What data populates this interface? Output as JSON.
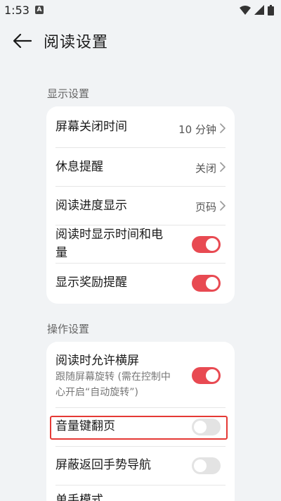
{
  "status_bar": {
    "time": "1:53",
    "notification_icon": "A",
    "icons": [
      "wifi-icon",
      "signal-icon",
      "battery-icon"
    ]
  },
  "header": {
    "title": "阅读设置",
    "back_icon": "arrow-left-icon"
  },
  "display_section": {
    "label": "显示设置",
    "items": [
      {
        "label": "屏幕关闭时间",
        "value": "10 分钟"
      },
      {
        "label": "休息提醒",
        "value": "关闭"
      },
      {
        "label": "阅读进度显示",
        "value": "页码"
      },
      {
        "label_line1": "阅读时显示时间和电",
        "label_line2": "量",
        "toggle": true
      },
      {
        "label": "显示奖励提醒",
        "toggle": true
      }
    ]
  },
  "operation_section": {
    "label": "操作设置",
    "items": [
      {
        "label": "阅读时允许横屏",
        "sub_line1": "跟随屏幕旋转 (需在控制中",
        "sub_line2": "心开启“自动旋转”)",
        "toggle": true
      },
      {
        "label": "音量键翻页",
        "toggle": false
      },
      {
        "label": "屏蔽返回手势导航",
        "toggle": false
      },
      {
        "label": "单手模式"
      }
    ]
  },
  "colors": {
    "toggle_on": "#e84a52",
    "toggle_off": "#e3e3e3",
    "highlight": "#e53935",
    "background": "#f1f3f5"
  }
}
